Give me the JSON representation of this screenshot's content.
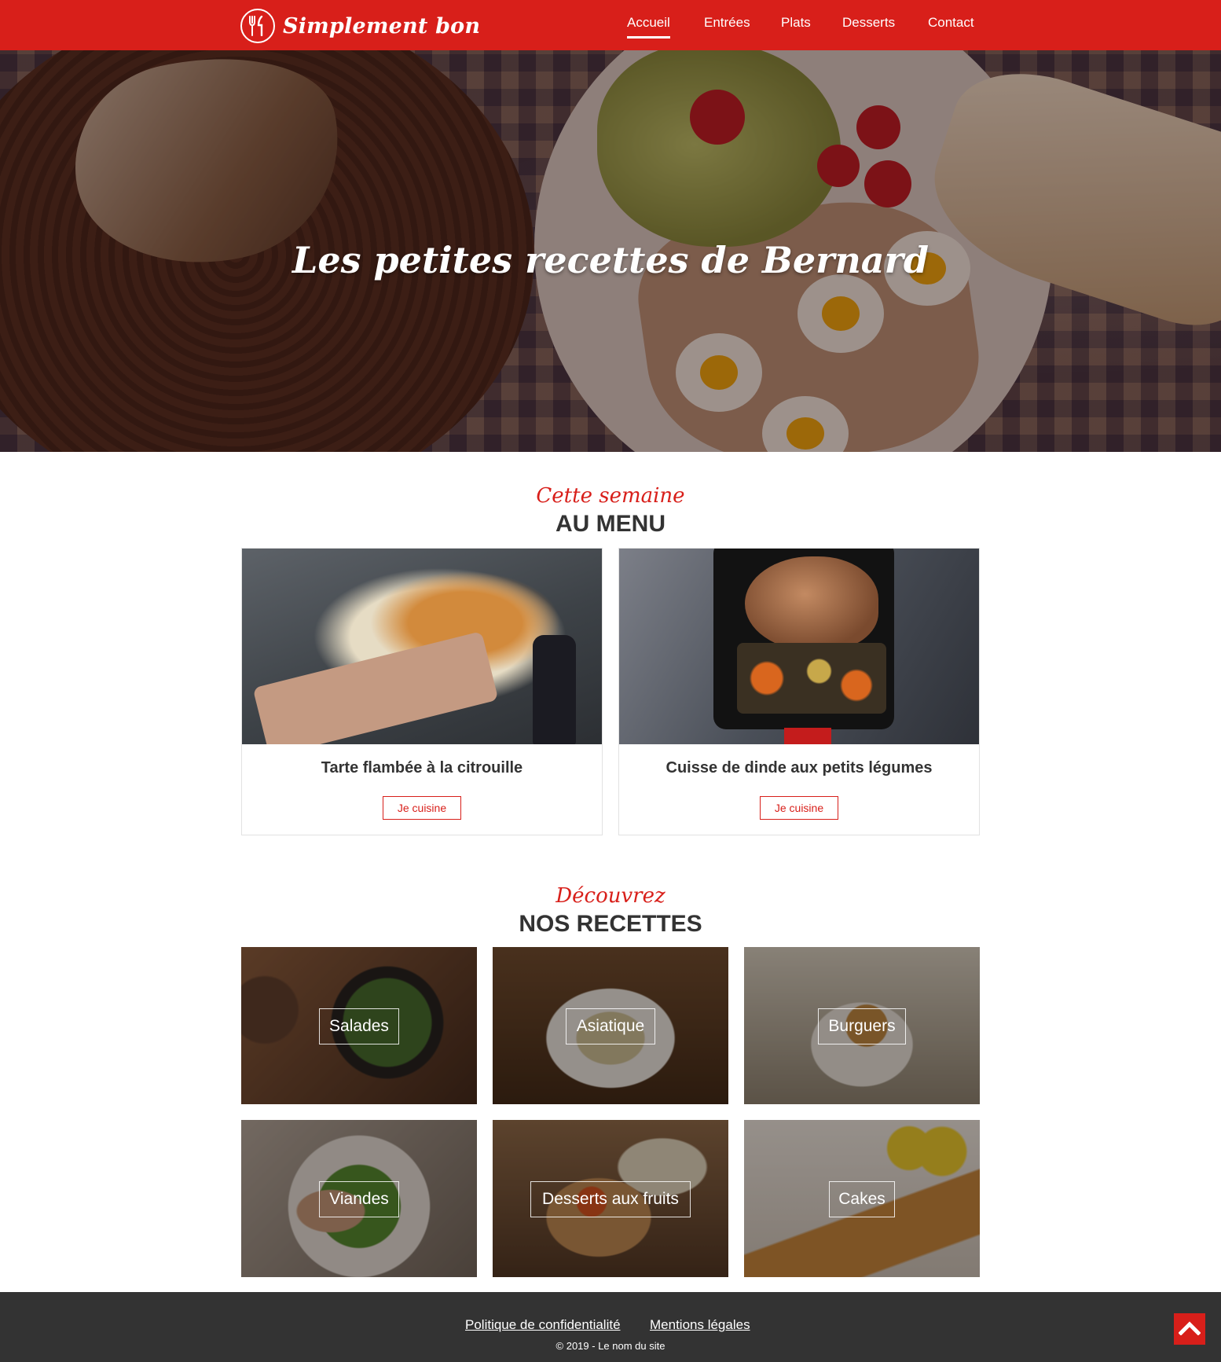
{
  "colors": {
    "accent": "#d81f1a",
    "dark": "#333333",
    "white": "#ffffff"
  },
  "header": {
    "logo_text": "Simplement bon",
    "logo_icon": "fork-knife-icon",
    "nav": [
      {
        "label": "Accueil",
        "active": true
      },
      {
        "label": "Entrées",
        "active": false
      },
      {
        "label": "Plats",
        "active": false
      },
      {
        "label": "Desserts",
        "active": false
      },
      {
        "label": "Contact",
        "active": false
      }
    ]
  },
  "hero": {
    "title": "Les petites recettes de Bernard"
  },
  "menu_section": {
    "script": "Cette semaine",
    "title": "AU MENU",
    "cards": [
      {
        "name": "Tarte flambée à la citrouille",
        "button": "Je cuisine"
      },
      {
        "name": "Cuisse de dinde aux petits légumes",
        "button": "Je cuisine"
      }
    ]
  },
  "recipes_section": {
    "script": "Découvrez",
    "title": "NOS RECETTES",
    "tiles": [
      {
        "label": "Salades"
      },
      {
        "label": "Asiatique"
      },
      {
        "label": "Burguers"
      },
      {
        "label": "Viandes"
      },
      {
        "label": "Desserts aux fruits"
      },
      {
        "label": "Cakes"
      }
    ]
  },
  "footer": {
    "links": [
      "Politique de confidentialité",
      "Mentions légales"
    ],
    "copyright": "© 2019 - Le nom du site",
    "back_to_top_icon": "chevron-up-icon"
  }
}
